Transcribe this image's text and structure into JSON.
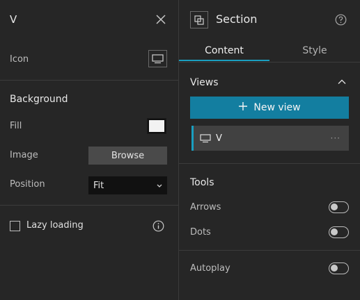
{
  "left_panel": {
    "title": "V",
    "icon_label": "Icon",
    "background_heading": "Background",
    "fill_label": "Fill",
    "fill_color": "#f2f2f2",
    "image_label": "Image",
    "browse_label": "Browse",
    "position_label": "Position",
    "position_value": "Fit",
    "lazy_loading_label": "Lazy loading",
    "lazy_loading_checked": false
  },
  "right_panel": {
    "title": "Section",
    "tabs": [
      {
        "label": "Content",
        "active": true
      },
      {
        "label": "Style",
        "active": false
      }
    ],
    "views_heading": "Views",
    "new_view_label": "New view",
    "views": [
      {
        "label": "V",
        "icon": "monitor-icon"
      }
    ],
    "more_glyph": "···",
    "tools_heading": "Tools",
    "arrows_label": "Arrows",
    "arrows_on": false,
    "dots_label": "Dots",
    "dots_on": false,
    "autoplay_label": "Autoplay",
    "autoplay_on": false
  },
  "colors": {
    "accent": "#1a9fc0",
    "button": "#137ea0",
    "panel": "#262626"
  }
}
